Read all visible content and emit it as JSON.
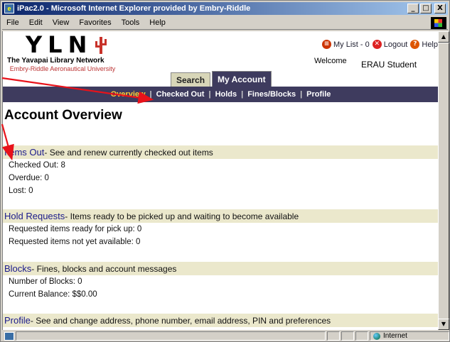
{
  "window": {
    "title": "iPac2.0 - Microsoft Internet Explorer provided by Embry-Riddle",
    "controls": [
      "_",
      "□",
      "X"
    ]
  },
  "menubar": {
    "items": [
      "File",
      "Edit",
      "View",
      "Favorites",
      "Tools",
      "Help"
    ]
  },
  "header": {
    "logo_text": "YLN",
    "network": "The Yavapai Library Network",
    "university": "Embry-Riddle Aeronautical University",
    "my_list": "My List - 0",
    "logout": "Logout",
    "help": "Help",
    "welcome": "Welcome",
    "user": "ERAU Student"
  },
  "tabs": [
    {
      "label": "Search",
      "active": false
    },
    {
      "label": "My Account",
      "active": true
    }
  ],
  "nav": {
    "items": [
      "Overview",
      "Checked Out",
      "Holds",
      "Fines/Blocks",
      "Profile"
    ],
    "active": "Overview"
  },
  "page": {
    "title": "Account Overview",
    "sections": [
      {
        "title": "Items Out",
        "desc": "- See and renew currently checked out items",
        "rows": [
          "Checked Out: 8",
          "Overdue: 0",
          "Lost: 0"
        ]
      },
      {
        "title": "Hold Requests",
        "desc": "- Items ready to be picked up and waiting to become available",
        "rows": [
          "Requested items ready for pick up: 0",
          "Requested items not yet available: 0"
        ]
      },
      {
        "title": "Blocks",
        "desc": "- Fines, blocks and account messages",
        "rows": [
          "Number of Blocks: 0",
          "Current Balance: $$0.00"
        ]
      },
      {
        "title": "Profile",
        "desc": "- See and change address, phone number, email address, PIN and preferences",
        "rows": []
      }
    ]
  },
  "statusbar": {
    "zone": "Internet"
  },
  "colors": {
    "nav_bg": "#3e3b5e",
    "nav_active": "#ffcc33",
    "section_bg": "#ebe8cc",
    "section_title": "#1a1a8a",
    "annotation_arrow": "#e8121a"
  }
}
